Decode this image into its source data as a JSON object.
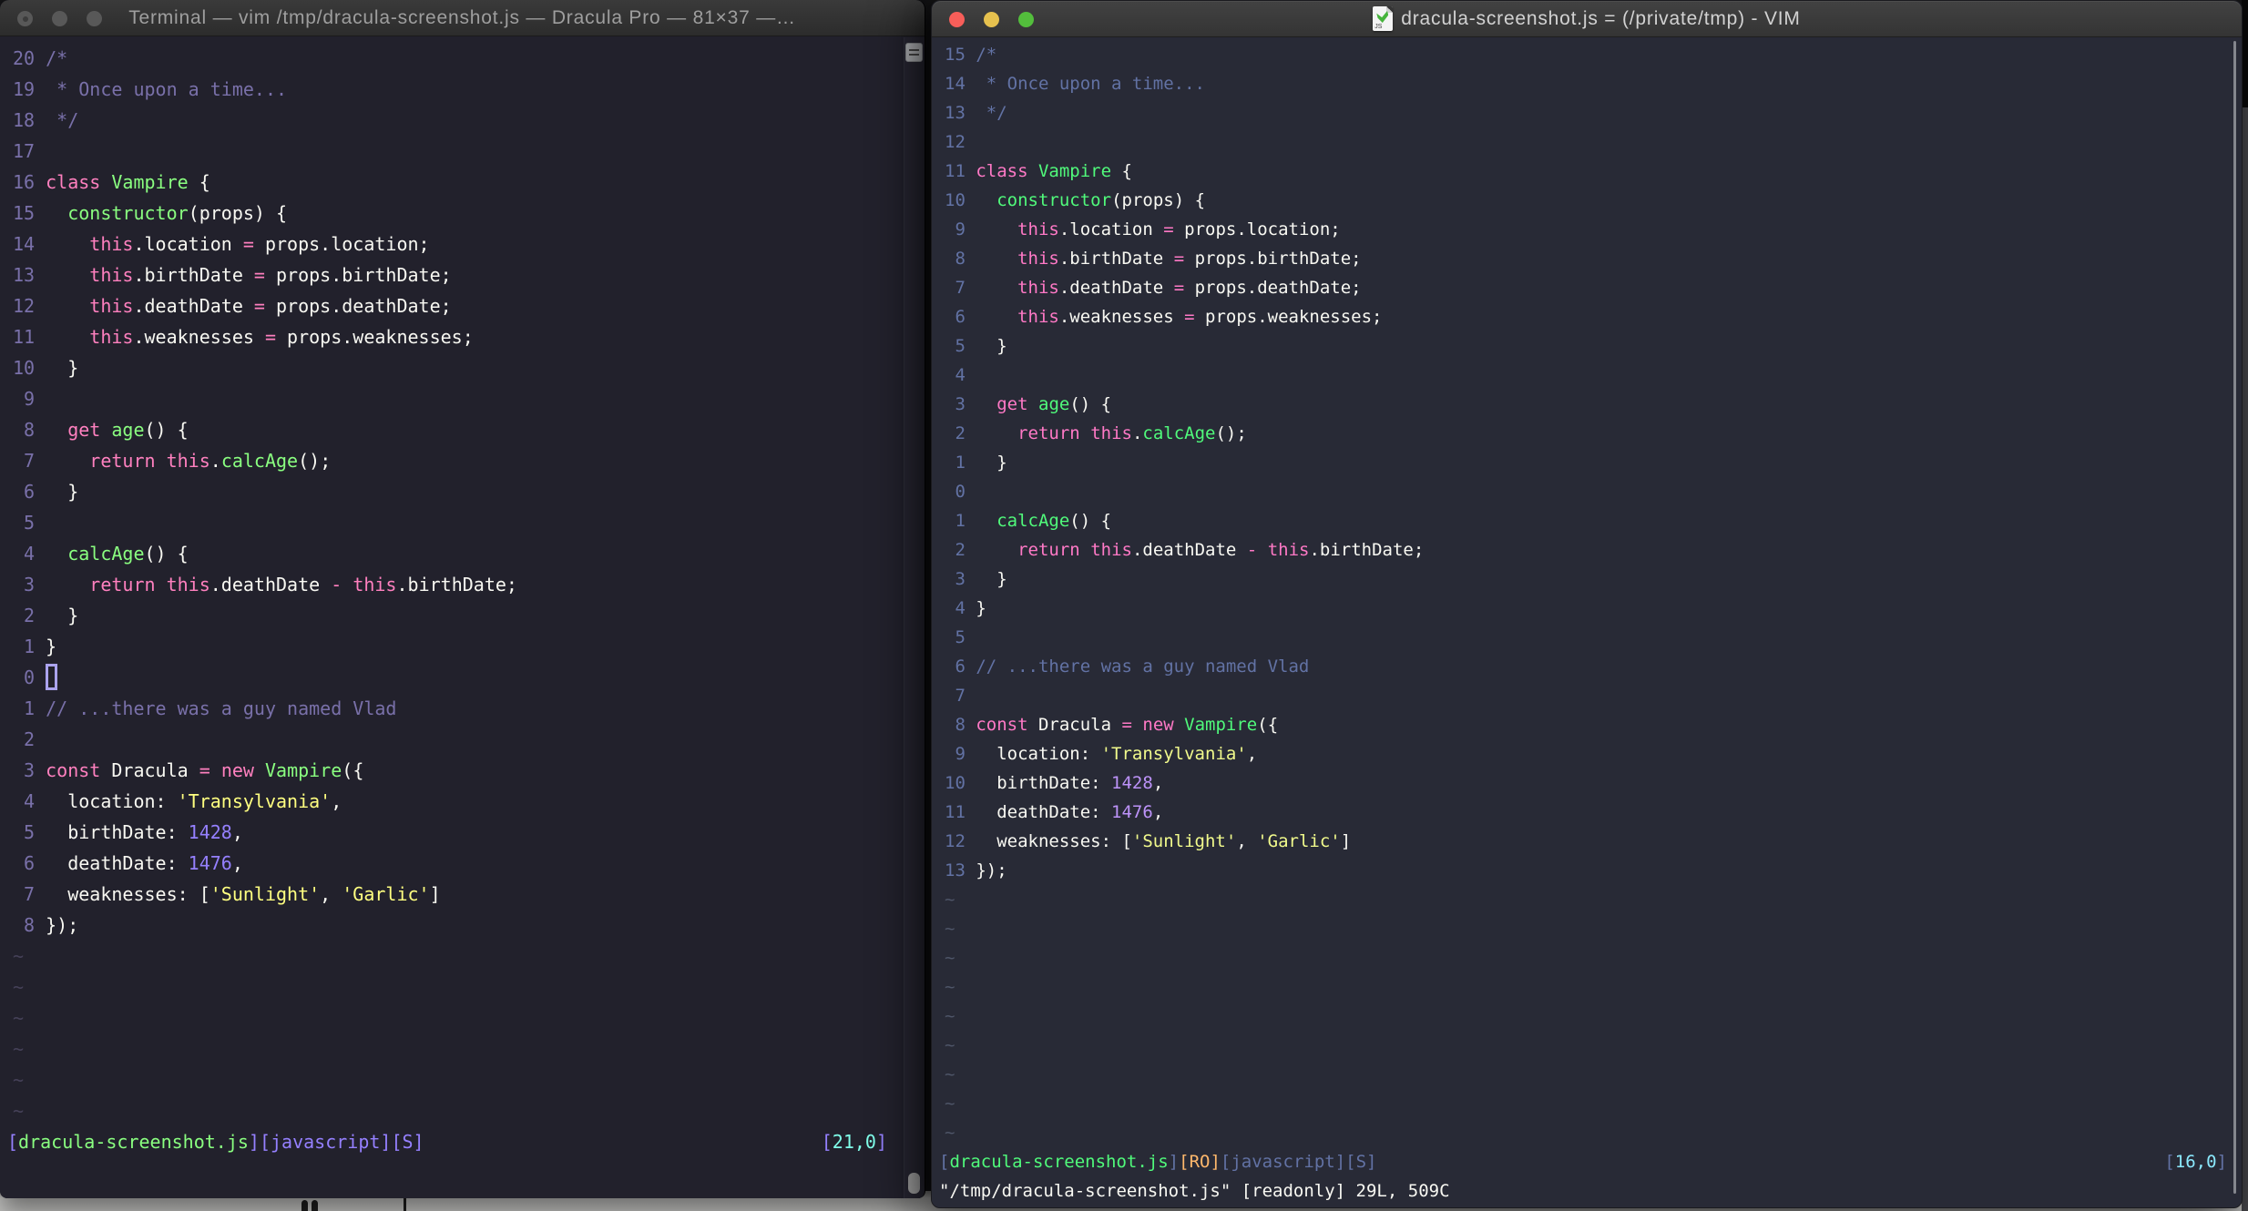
{
  "palettes": {
    "dracula_pro": {
      "bg": "#22212C",
      "fg": "#F8F8F2",
      "com": "#7970A9",
      "kw": "#FF80BF",
      "op": "#FF80BF",
      "fn": "#8AFF80",
      "str": "#FFFF80",
      "num": "#9580FF",
      "cyan": "#80FFEA",
      "purple": "#9580FF",
      "green": "#8AFF80",
      "orange": "#FFCA80",
      "lnr": "#7970A9",
      "tilde": "#454158"
    },
    "dracula": {
      "bg": "#282A36",
      "fg": "#F8F8F2",
      "com": "#6272A4",
      "kw": "#FF79C6",
      "op": "#FF79C6",
      "fn": "#50FA7B",
      "str": "#F1FA8C",
      "num": "#BD93F9",
      "cyan": "#8BE9FD",
      "purple": "#BD93F9",
      "green": "#50FA7B",
      "orange": "#FFB86C",
      "lnr": "#6272A4",
      "tilde": "#4E5568"
    }
  },
  "code": {
    "language": "javascript",
    "tilde": "~",
    "lines": [
      [
        [
          "com",
          "/*"
        ]
      ],
      [
        [
          "com",
          " * Once upon a time..."
        ]
      ],
      [
        [
          "com",
          " */"
        ]
      ],
      [],
      [
        [
          "kw",
          "class"
        ],
        [
          "fg",
          " "
        ],
        [
          "fn",
          "Vampire"
        ],
        [
          "fg",
          " {"
        ]
      ],
      [
        [
          "fg",
          "  "
        ],
        [
          "fn",
          "constructor"
        ],
        [
          "fg",
          "(props) {"
        ]
      ],
      [
        [
          "fg",
          "    "
        ],
        [
          "kw",
          "this"
        ],
        [
          "fg",
          ".location "
        ],
        [
          "op",
          "="
        ],
        [
          "fg",
          " props.location;"
        ]
      ],
      [
        [
          "fg",
          "    "
        ],
        [
          "kw",
          "this"
        ],
        [
          "fg",
          ".birthDate "
        ],
        [
          "op",
          "="
        ],
        [
          "fg",
          " props.birthDate;"
        ]
      ],
      [
        [
          "fg",
          "    "
        ],
        [
          "kw",
          "this"
        ],
        [
          "fg",
          ".deathDate "
        ],
        [
          "op",
          "="
        ],
        [
          "fg",
          " props.deathDate;"
        ]
      ],
      [
        [
          "fg",
          "    "
        ],
        [
          "kw",
          "this"
        ],
        [
          "fg",
          ".weaknesses "
        ],
        [
          "op",
          "="
        ],
        [
          "fg",
          " props.weaknesses;"
        ]
      ],
      [
        [
          "fg",
          "  }"
        ]
      ],
      [],
      [
        [
          "fg",
          "  "
        ],
        [
          "kw",
          "get"
        ],
        [
          "fg",
          " "
        ],
        [
          "fn",
          "age"
        ],
        [
          "fg",
          "() {"
        ]
      ],
      [
        [
          "fg",
          "    "
        ],
        [
          "kw",
          "return"
        ],
        [
          "fg",
          " "
        ],
        [
          "kw",
          "this"
        ],
        [
          "fg",
          "."
        ],
        [
          "fn",
          "calcAge"
        ],
        [
          "fg",
          "();"
        ]
      ],
      [
        [
          "fg",
          "  }"
        ]
      ],
      [],
      [
        [
          "fg",
          "  "
        ],
        [
          "fn",
          "calcAge"
        ],
        [
          "fg",
          "() {"
        ]
      ],
      [
        [
          "fg",
          "    "
        ],
        [
          "kw",
          "return"
        ],
        [
          "fg",
          " "
        ],
        [
          "kw",
          "this"
        ],
        [
          "fg",
          ".deathDate "
        ],
        [
          "op",
          "-"
        ],
        [
          "fg",
          " "
        ],
        [
          "kw",
          "this"
        ],
        [
          "fg",
          ".birthDate;"
        ]
      ],
      [
        [
          "fg",
          "  }"
        ]
      ],
      [
        [
          "fg",
          "}"
        ]
      ],
      [],
      [
        [
          "com",
          "// ...there was a guy named Vlad"
        ]
      ],
      [],
      [
        [
          "kw",
          "const"
        ],
        [
          "fg",
          " Dracula "
        ],
        [
          "op",
          "="
        ],
        [
          "fg",
          " "
        ],
        [
          "kw",
          "new"
        ],
        [
          "fg",
          " "
        ],
        [
          "fn",
          "Vampire"
        ],
        [
          "fg",
          "({"
        ]
      ],
      [
        [
          "fg",
          "  location: "
        ],
        [
          "str",
          "'Transylvania'"
        ],
        [
          "fg",
          ","
        ]
      ],
      [
        [
          "fg",
          "  birthDate: "
        ],
        [
          "num",
          "1428"
        ],
        [
          "fg",
          ","
        ]
      ],
      [
        [
          "fg",
          "  deathDate: "
        ],
        [
          "num",
          "1476"
        ],
        [
          "fg",
          ","
        ]
      ],
      [
        [
          "fg",
          "  weaknesses: ["
        ],
        [
          "str",
          "'Sunlight'"
        ],
        [
          "fg",
          ", "
        ],
        [
          "str",
          "'Garlic'"
        ],
        [
          "fg",
          "]"
        ]
      ],
      [
        [
          "fg",
          "});"
        ]
      ]
    ]
  },
  "left_window": {
    "app": "Terminal",
    "title": "Terminal — vim /tmp/dracula-screenshot.js — Dracula Pro — 81×37 —…",
    "palette": "dracula_pro",
    "cursor_line": 21,
    "cursor_col": 0,
    "tilde_count": 6,
    "status_left": [
      [
        "purple",
        "["
      ],
      [
        "green",
        "dracula-screenshot.js"
      ],
      [
        "purple",
        "][javascript][S]"
      ]
    ],
    "status_right": [
      [
        "purple",
        "["
      ],
      [
        "cyan",
        "21,0"
      ],
      [
        "purple",
        "]"
      ]
    ],
    "command_line": ""
  },
  "right_window": {
    "app": "VIM",
    "title": "dracula-screenshot.js = (/private/tmp) - VIM",
    "palette": "dracula",
    "cursor_line": 16,
    "cursor_col": 0,
    "tilde_count": 9,
    "status_left": [
      [
        "com",
        "["
      ],
      [
        "green",
        "dracula-screenshot.js"
      ],
      [
        "com",
        "]"
      ],
      [
        "orange",
        "[RO]"
      ],
      [
        "com",
        "[javascript][S]"
      ]
    ],
    "status_right": [
      [
        "com",
        "["
      ],
      [
        "cyan",
        "16,0"
      ],
      [
        "com",
        "]"
      ]
    ],
    "command_line": "\"/tmp/dracula-screenshot.js\" [readonly] 29L, 509C"
  }
}
